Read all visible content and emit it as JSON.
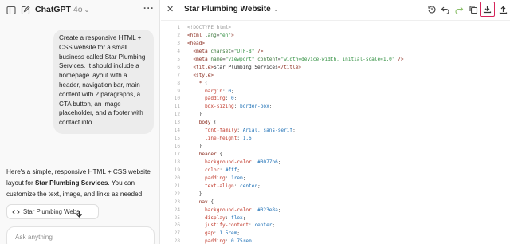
{
  "left": {
    "model_name": "ChatGPT",
    "model_version": "4o",
    "user_message": "Create a responsive HTML + CSS website for a small business called Star Plumbing Services. It should include a homepage layout with a header, navigation bar, main content with 2 paragraphs, a CTA button, an image placeholder, and a footer with contact info",
    "assistant_intro_1": "Here's a simple, responsive HTML + CSS website layout for ",
    "assistant_bold": "Star Plumbing Services",
    "assistant_intro_2": ". You can customize the text, image, and links as needed.",
    "file_pill_label": "Star Plumbing Webs",
    "composer_placeholder": "Ask anything"
  },
  "right": {
    "document_title": "Star Plumbing Website",
    "toolbar": [
      "history-icon",
      "undo-icon",
      "redo-icon",
      "copy-icon",
      "download-icon",
      "share-icon"
    ],
    "highlight_color": "#d6245a"
  },
  "code_lines": [
    {
      "n": "1",
      "parts": [
        [
          "cmt",
          "<!DOCTYPE html>"
        ]
      ]
    },
    {
      "n": "2",
      "parts": [
        [
          "tag",
          "<html "
        ],
        [
          "attr",
          "lang"
        ],
        [
          "pun",
          "="
        ],
        [
          "str",
          "\"en\""
        ],
        [
          "tag",
          ">"
        ]
      ]
    },
    {
      "n": "3",
      "parts": [
        [
          "tag",
          "<head>"
        ]
      ]
    },
    {
      "n": "4",
      "parts": [
        [
          "txt",
          "  "
        ],
        [
          "tag",
          "<meta "
        ],
        [
          "attr",
          "charset"
        ],
        [
          "pun",
          "="
        ],
        [
          "str",
          "\"UTF-8\""
        ],
        [
          "tag",
          " />"
        ]
      ]
    },
    {
      "n": "5",
      "parts": [
        [
          "txt",
          "  "
        ],
        [
          "tag",
          "<meta "
        ],
        [
          "attr",
          "name"
        ],
        [
          "pun",
          "="
        ],
        [
          "str",
          "\"viewport\""
        ],
        [
          "attr",
          " content"
        ],
        [
          "pun",
          "="
        ],
        [
          "str",
          "\"width=device-width, initial-scale=1.0\""
        ],
        [
          "tag",
          " />"
        ]
      ]
    },
    {
      "n": "6",
      "parts": [
        [
          "txt",
          "  "
        ],
        [
          "tag",
          "<title>"
        ],
        [
          "txt",
          "Star Plumbing Services"
        ],
        [
          "tag",
          "</title>"
        ]
      ]
    },
    {
      "n": "7",
      "parts": [
        [
          "txt",
          "  "
        ],
        [
          "tag",
          "<style>"
        ]
      ]
    },
    {
      "n": "8",
      "parts": [
        [
          "txt",
          "    "
        ],
        [
          "sel",
          "* "
        ],
        [
          "pun",
          "{"
        ]
      ]
    },
    {
      "n": "9",
      "parts": [
        [
          "txt",
          "      "
        ],
        [
          "prop",
          "margin"
        ],
        [
          "pun",
          ": "
        ],
        [
          "val",
          "0"
        ],
        [
          "pun",
          ";"
        ]
      ]
    },
    {
      "n": "10",
      "parts": [
        [
          "txt",
          "      "
        ],
        [
          "prop",
          "padding"
        ],
        [
          "pun",
          ": "
        ],
        [
          "val",
          "0"
        ],
        [
          "pun",
          ";"
        ]
      ]
    },
    {
      "n": "11",
      "parts": [
        [
          "txt",
          "      "
        ],
        [
          "prop",
          "box-sizing"
        ],
        [
          "pun",
          ": "
        ],
        [
          "val",
          "border-box"
        ],
        [
          "pun",
          ";"
        ]
      ]
    },
    {
      "n": "12",
      "parts": [
        [
          "txt",
          "    "
        ],
        [
          "pun",
          "}"
        ]
      ]
    },
    {
      "n": "13",
      "parts": [
        [
          "txt",
          "    "
        ],
        [
          "sel",
          "body "
        ],
        [
          "pun",
          "{"
        ]
      ]
    },
    {
      "n": "14",
      "parts": [
        [
          "txt",
          "      "
        ],
        [
          "prop",
          "font-family"
        ],
        [
          "pun",
          ": "
        ],
        [
          "val",
          "Arial, sans-serif"
        ],
        [
          "pun",
          ";"
        ]
      ]
    },
    {
      "n": "15",
      "parts": [
        [
          "txt",
          "      "
        ],
        [
          "prop",
          "line-height"
        ],
        [
          "pun",
          ": "
        ],
        [
          "val",
          "1.6"
        ],
        [
          "pun",
          ";"
        ]
      ]
    },
    {
      "n": "16",
      "parts": [
        [
          "txt",
          "    "
        ],
        [
          "pun",
          "}"
        ]
      ]
    },
    {
      "n": "17",
      "parts": [
        [
          "txt",
          "    "
        ],
        [
          "sel",
          "header "
        ],
        [
          "pun",
          "{"
        ]
      ]
    },
    {
      "n": "18",
      "parts": [
        [
          "txt",
          "      "
        ],
        [
          "prop",
          "background-color"
        ],
        [
          "pun",
          ": "
        ],
        [
          "val",
          "#0077b6"
        ],
        [
          "pun",
          ";"
        ]
      ]
    },
    {
      "n": "19",
      "parts": [
        [
          "txt",
          "      "
        ],
        [
          "prop",
          "color"
        ],
        [
          "pun",
          ": "
        ],
        [
          "val",
          "#fff"
        ],
        [
          "pun",
          ";"
        ]
      ]
    },
    {
      "n": "20",
      "parts": [
        [
          "txt",
          "      "
        ],
        [
          "prop",
          "padding"
        ],
        [
          "pun",
          ": "
        ],
        [
          "val",
          "1rem"
        ],
        [
          "pun",
          ";"
        ]
      ]
    },
    {
      "n": "21",
      "parts": [
        [
          "txt",
          "      "
        ],
        [
          "prop",
          "text-align"
        ],
        [
          "pun",
          ": "
        ],
        [
          "val",
          "center"
        ],
        [
          "pun",
          ";"
        ]
      ]
    },
    {
      "n": "22",
      "parts": [
        [
          "txt",
          "    "
        ],
        [
          "pun",
          "}"
        ]
      ]
    },
    {
      "n": "23",
      "parts": [
        [
          "txt",
          "    "
        ],
        [
          "sel",
          "nav "
        ],
        [
          "pun",
          "{"
        ]
      ]
    },
    {
      "n": "24",
      "parts": [
        [
          "txt",
          "      "
        ],
        [
          "prop",
          "background-color"
        ],
        [
          "pun",
          ": "
        ],
        [
          "val",
          "#023e8a"
        ],
        [
          "pun",
          ";"
        ]
      ]
    },
    {
      "n": "25",
      "parts": [
        [
          "txt",
          "      "
        ],
        [
          "prop",
          "display"
        ],
        [
          "pun",
          ": "
        ],
        [
          "val",
          "flex"
        ],
        [
          "pun",
          ";"
        ]
      ]
    },
    {
      "n": "26",
      "parts": [
        [
          "txt",
          "      "
        ],
        [
          "prop",
          "justify-content"
        ],
        [
          "pun",
          ": "
        ],
        [
          "val",
          "center"
        ],
        [
          "pun",
          ";"
        ]
      ]
    },
    {
      "n": "27",
      "parts": [
        [
          "txt",
          "      "
        ],
        [
          "prop",
          "gap"
        ],
        [
          "pun",
          ": "
        ],
        [
          "val",
          "1.5rem"
        ],
        [
          "pun",
          ";"
        ]
      ]
    },
    {
      "n": "28",
      "parts": [
        [
          "txt",
          "      "
        ],
        [
          "prop",
          "padding"
        ],
        [
          "pun",
          ": "
        ],
        [
          "val",
          "0.75rem"
        ],
        [
          "pun",
          ";"
        ]
      ]
    }
  ]
}
